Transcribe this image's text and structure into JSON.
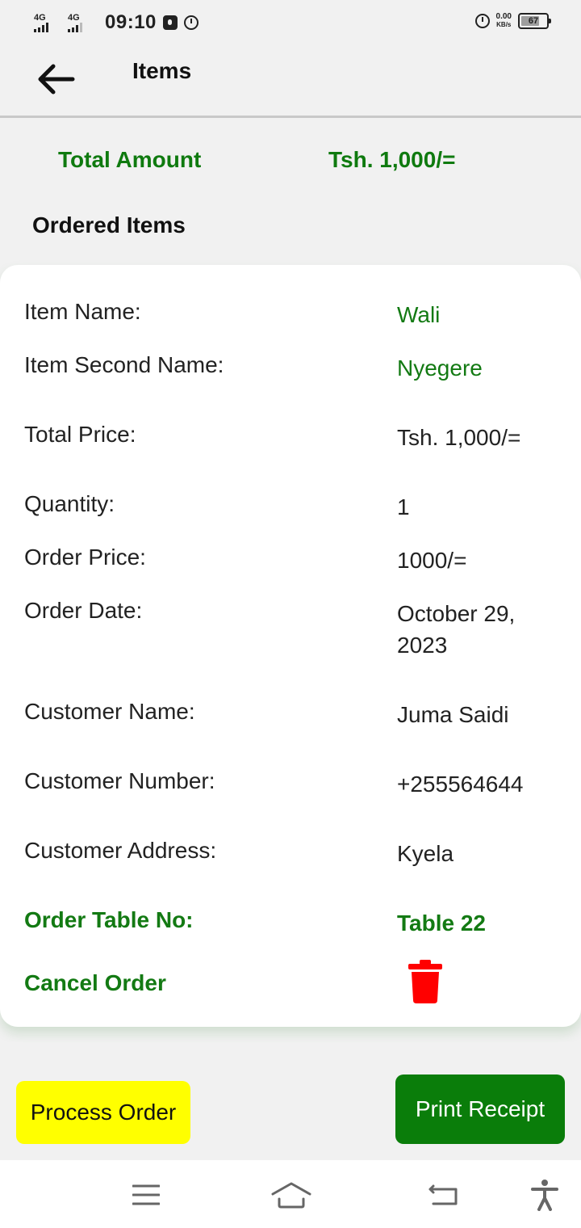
{
  "status_bar": {
    "net1": "4G",
    "net2": "4G",
    "time": "09:10",
    "speed_value": "0.00",
    "speed_unit": "KB/s",
    "battery": "67"
  },
  "app_bar": {
    "title": "Items",
    "back_icon": "arrow-left-icon"
  },
  "summary": {
    "total_label": "Total Amount",
    "total_value": "Tsh. 1,000/=",
    "section_title": "Ordered Items"
  },
  "order": {
    "item_name_label": "Item Name:",
    "item_name_value": "Wali",
    "item_second_name_label": "Item Second Name:",
    "item_second_name_value": "Nyegere",
    "total_price_label": "Total Price:",
    "total_price_value": "Tsh. 1,000/=",
    "quantity_label": "Quantity:",
    "quantity_value": "1",
    "order_price_label": "Order Price:",
    "order_price_value": "1000/=",
    "order_date_label": "Order Date:",
    "order_date_value": "October 29, 2023",
    "customer_name_label": "Customer Name:",
    "customer_name_value": "Juma Saidi",
    "customer_number_label": "Customer Number:",
    "customer_number_value": "+255564644",
    "customer_address_label": "Customer Address:",
    "customer_address_value": "Kyela",
    "table_label": "Order Table No:",
    "table_value": "Table 22",
    "cancel_label": "Cancel Order",
    "cancel_icon": "trash-icon"
  },
  "actions": {
    "process_label": "Process Order",
    "print_label": "Print Receipt"
  },
  "colors": {
    "accent_green": "#137a13",
    "process_yellow": "#ffff00",
    "print_green": "#0a7d0a",
    "delete_red": "#ff0000"
  },
  "nav_bar": {
    "icons": [
      "menu-icon",
      "home-icon",
      "back-icon",
      "accessibility-icon"
    ]
  }
}
